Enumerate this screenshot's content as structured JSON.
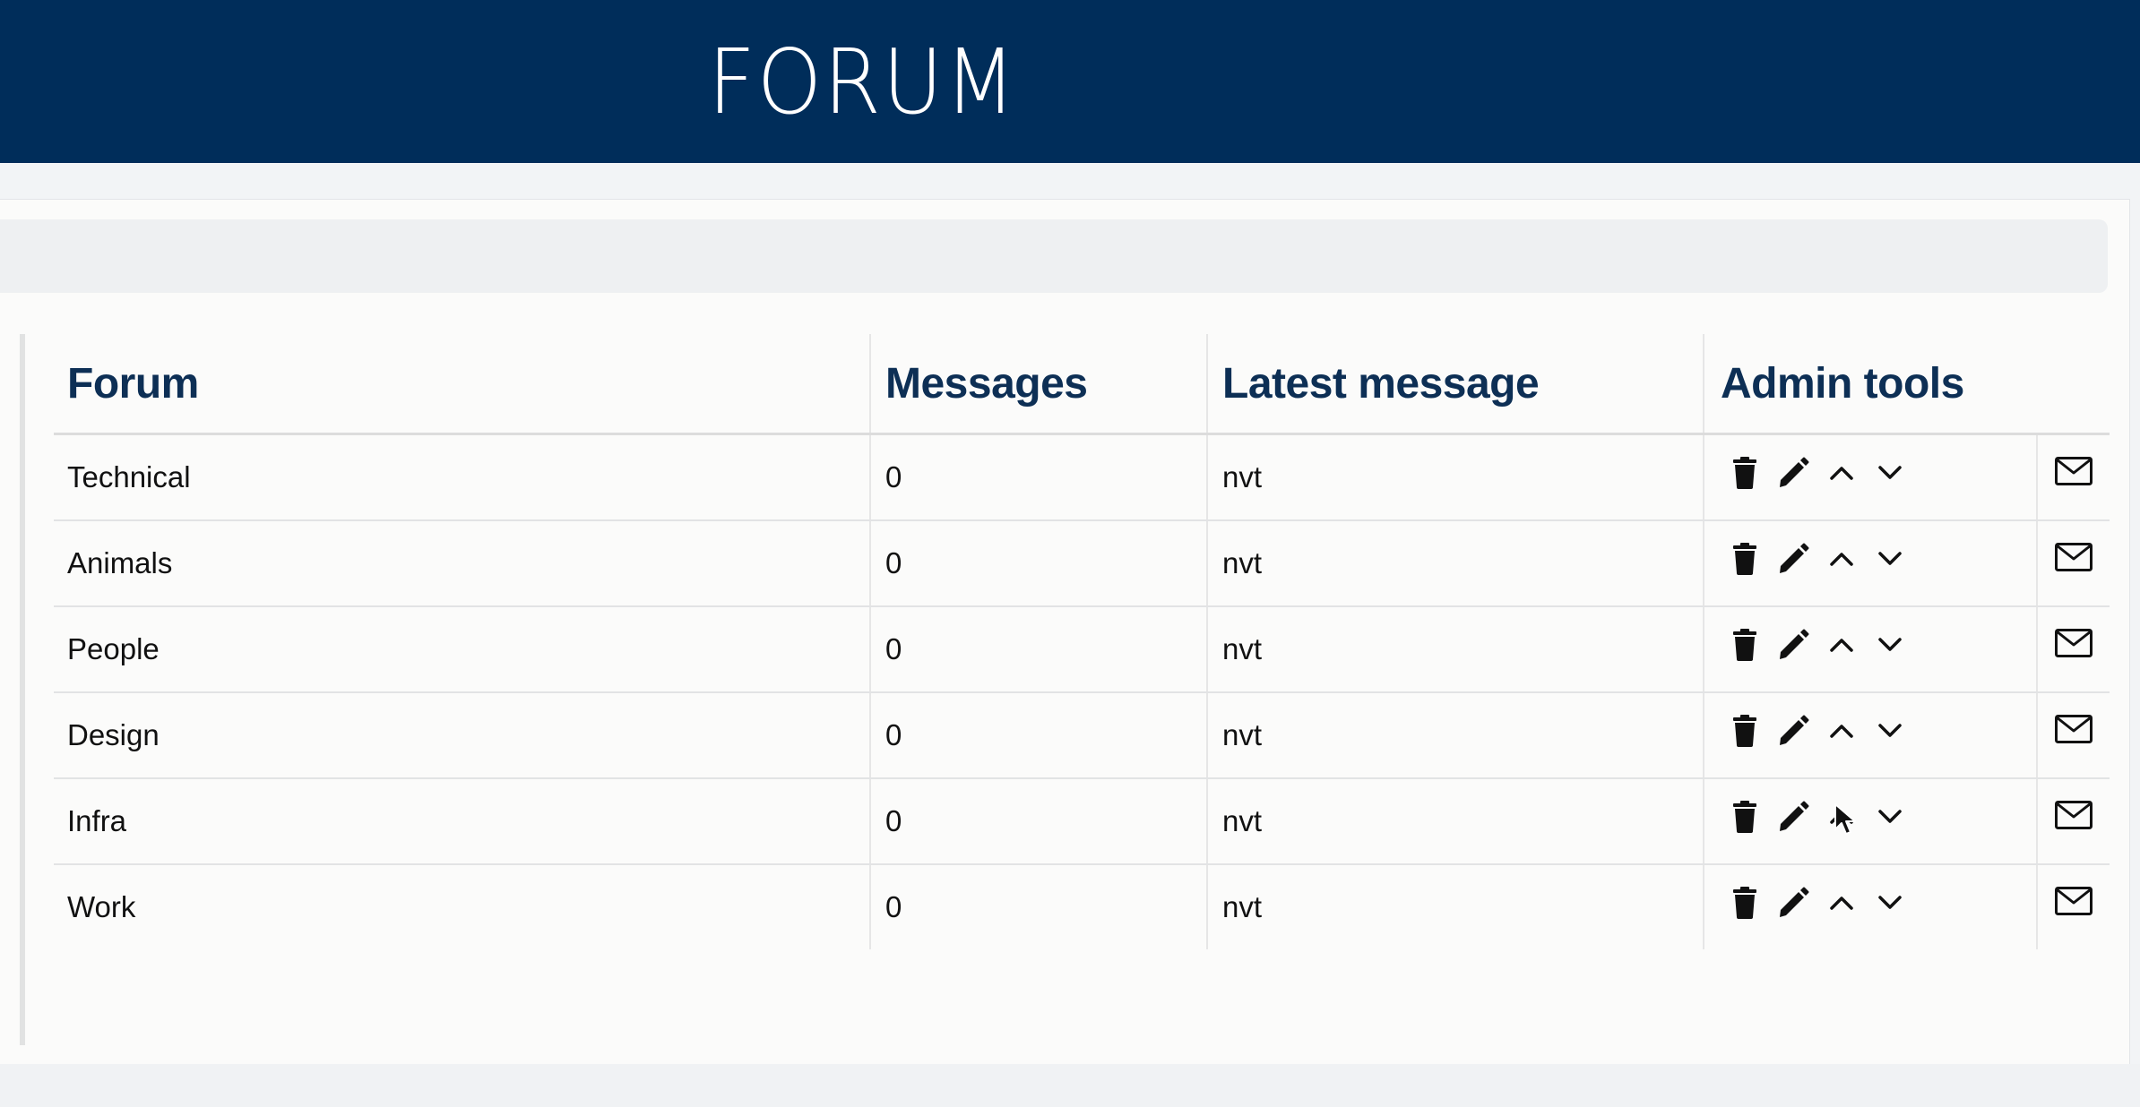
{
  "header": {
    "title": "FORUM"
  },
  "table": {
    "columns": {
      "forum": "Forum",
      "messages": "Messages",
      "latest": "Latest message",
      "admin": "Admin tools"
    },
    "rows": [
      {
        "forum": "Technical",
        "messages": "0",
        "latest": "nvt"
      },
      {
        "forum": "Animals",
        "messages": "0",
        "latest": "nvt"
      },
      {
        "forum": "People",
        "messages": "0",
        "latest": "nvt"
      },
      {
        "forum": "Design",
        "messages": "0",
        "latest": "nvt"
      },
      {
        "forum": "Infra",
        "messages": "0",
        "latest": "nvt"
      },
      {
        "forum": "Work",
        "messages": "0",
        "latest": "nvt"
      }
    ],
    "admin_tools": [
      "trash-icon",
      "pencil-icon",
      "chevron-up-icon",
      "chevron-down-icon"
    ],
    "row_action": "mail-icon"
  },
  "colors": {
    "header_bg": "#002d5a",
    "heading_text": "#0d2f55",
    "panel_bg": "#fbfbfa"
  }
}
